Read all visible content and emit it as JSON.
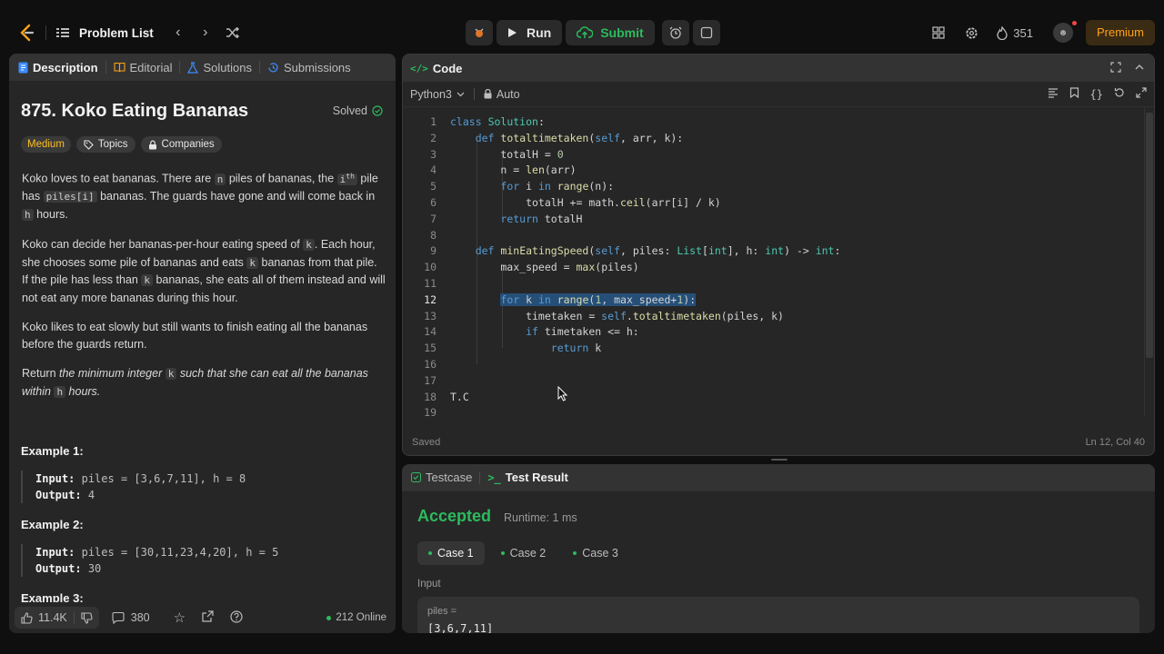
{
  "topbar": {
    "problem_list": "Problem List",
    "run": "Run",
    "submit": "Submit",
    "streak": "351",
    "premium": "Premium"
  },
  "left_tabs": [
    "Description",
    "Editorial",
    "Solutions",
    "Submissions"
  ],
  "problem": {
    "title": "875. Koko Eating Bananas",
    "status": "Solved",
    "difficulty": "Medium",
    "topics": "Topics",
    "companies": "Companies",
    "p1_a": "Koko loves to eat bananas. There are ",
    "p1_n": "n",
    "p1_b": " piles of bananas, the ",
    "p1_i": "i",
    "p1_th": "th",
    "p1_c": " pile has ",
    "p1_piles": "piles[i]",
    "p1_d": " bananas. The guards have gone and will come back in ",
    "p1_h": "h",
    "p1_e": " hours.",
    "p2_a": "Koko can decide her bananas-per-hour eating speed of ",
    "p2_k": "k",
    "p2_b": ". Each hour, she chooses some pile of bananas and eats ",
    "p2_k2": "k",
    "p2_c": " bananas from that pile. If the pile has less than ",
    "p2_k3": "k",
    "p2_d": " bananas, she eats all of them instead and will not eat any more bananas during this hour.",
    "p3": "Koko likes to eat slowly but still wants to finish eating all the bananas before the guards return.",
    "p4_a": "Return ",
    "p4_b": "the minimum integer ",
    "p4_k": "k",
    "p4_c": " such that she can eat all the bananas within ",
    "p4_h": "h",
    "p4_d": " hours.",
    "examples": [
      {
        "title": "Example 1:",
        "input": "piles = [3,6,7,11], h = 8",
        "output": "4"
      },
      {
        "title": "Example 2:",
        "input": "piles = [30,11,23,4,20], h = 5",
        "output": "30"
      },
      {
        "title": "Example 3:"
      }
    ],
    "input_label": "Input:",
    "output_label": "Output:"
  },
  "bottom_bar": {
    "likes": "11.4K",
    "comments": "380",
    "online": "212 Online"
  },
  "code_panel": {
    "title": "Code",
    "language": "Python3",
    "mode": "Auto",
    "saved": "Saved",
    "position": "Ln 12, Col 40"
  },
  "code_lines": [
    "class Solution:",
    "    def totaltimetaken(self, arr, k):",
    "        totalH = 0",
    "        n = len(arr)",
    "        for i in range(n):",
    "            totalH += math.ceil(arr[i] / k)",
    "        return totalH",
    "",
    "    def minEatingSpeed(self, piles: List[int], h: int) -> int:",
    "        max_speed = max(piles)",
    "",
    "        for k in range(1, max_speed+1):",
    "            timetaken = self.totaltimetaken(piles, k)",
    "            if timetaken <= h:",
    "                return k",
    "",
    "",
    "T.C",
    ""
  ],
  "test_panel": {
    "tab_testcase": "Testcase",
    "tab_result": "Test Result",
    "verdict": "Accepted",
    "runtime": "Runtime: 1 ms",
    "cases": [
      "Case 1",
      "Case 2",
      "Case 3"
    ],
    "input_label": "Input",
    "var_label": "piles =",
    "var_value": "[3,6,7,11]"
  },
  "colors": {
    "accent_green": "#2cbb5d",
    "premium": "#ffa116",
    "medium": "#ffc01e"
  }
}
